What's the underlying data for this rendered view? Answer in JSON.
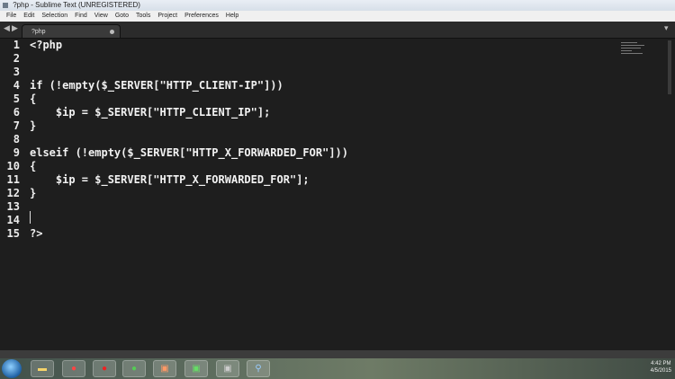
{
  "window": {
    "title": "?php - Sublime Text (UNREGISTERED)"
  },
  "menu": [
    "File",
    "Edit",
    "Selection",
    "Find",
    "View",
    "Goto",
    "Tools",
    "Project",
    "Preferences",
    "Help"
  ],
  "tab": {
    "label": "?php"
  },
  "editor": {
    "lines": [
      {
        "num": "1",
        "text": "<?php"
      },
      {
        "num": "2",
        "text": ""
      },
      {
        "num": "3",
        "text": ""
      },
      {
        "num": "4",
        "text": "if (!empty($_SERVER[\"HTTP_CLIENT-IP\"]))"
      },
      {
        "num": "5",
        "text": "{"
      },
      {
        "num": "6",
        "text": "    $ip = $_SERVER[\"HTTP_CLIENT_IP\"];"
      },
      {
        "num": "7",
        "text": "}"
      },
      {
        "num": "8",
        "text": ""
      },
      {
        "num": "9",
        "text": "elseif (!empty($_SERVER[\"HTTP_X_FORWARDED_FOR\"]))"
      },
      {
        "num": "10",
        "text": "{"
      },
      {
        "num": "11",
        "text": "    $ip = $_SERVER[\"HTTP_X_FORWARDED_FOR\"];"
      },
      {
        "num": "12",
        "text": "}"
      },
      {
        "num": "13",
        "text": ""
      },
      {
        "num": "14",
        "text": ""
      },
      {
        "num": "15",
        "text": "?>"
      }
    ]
  },
  "taskbar": {
    "time": "4:42 PM",
    "date": "4/5/2015"
  }
}
